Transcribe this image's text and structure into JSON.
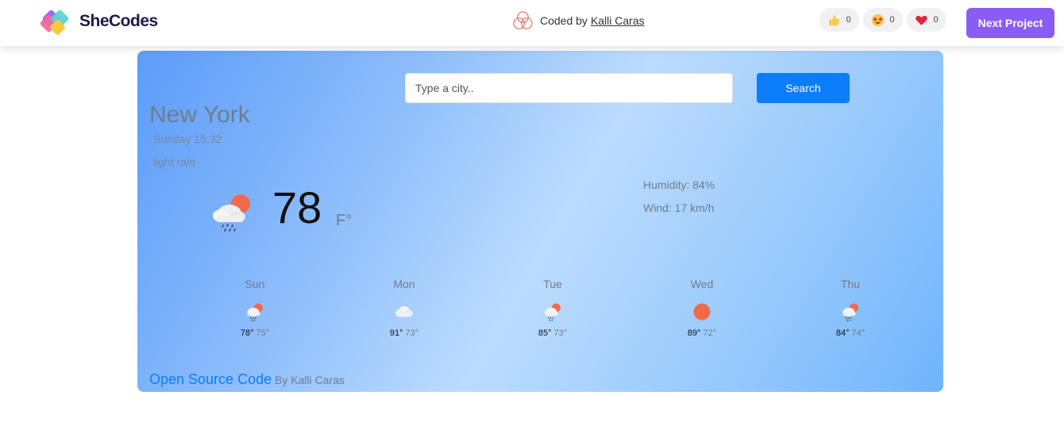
{
  "header": {
    "logo_text": "SheCodes",
    "coded_by_label": "Coded by",
    "author_link": "Kalli Caras",
    "reactions": [
      {
        "name": "thumbs-up-icon",
        "count": "0"
      },
      {
        "name": "star-struck-icon",
        "count": "0"
      },
      {
        "name": "heart-icon",
        "count": "0"
      }
    ],
    "next_button": "Next Project"
  },
  "search": {
    "placeholder": "Type a city..",
    "button_label": "Search"
  },
  "current": {
    "city": "New York",
    "date": "Sunday 15:32",
    "description": "light rain",
    "icon": "rain-cloud-sun-icon",
    "temperature": "78",
    "unit": "F°",
    "humidity": "Humidity: 84%",
    "wind": "Wind: 17 km/h"
  },
  "forecast": [
    {
      "day": "Sun",
      "icon": "rain-cloud-sun-icon",
      "max": "78°",
      "min": "75°"
    },
    {
      "day": "Mon",
      "icon": "cloud-icon",
      "max": "91°",
      "min": "73°"
    },
    {
      "day": "Tue",
      "icon": "rain-cloud-sun-icon",
      "max": "85°",
      "min": "73°"
    },
    {
      "day": "Wed",
      "icon": "sun-icon",
      "max": "89°",
      "min": "72°"
    },
    {
      "day": "Thu",
      "icon": "rain-cloud-sun-icon",
      "max": "84°",
      "min": "74°"
    }
  ],
  "footer": {
    "link_text": "Open Source Code",
    "by_text": "By Kalli Caras"
  },
  "colors": {
    "accent_purple": "#8a5cf6",
    "search_blue": "#0b7dfa",
    "sun_orange": "#f26a4a"
  }
}
